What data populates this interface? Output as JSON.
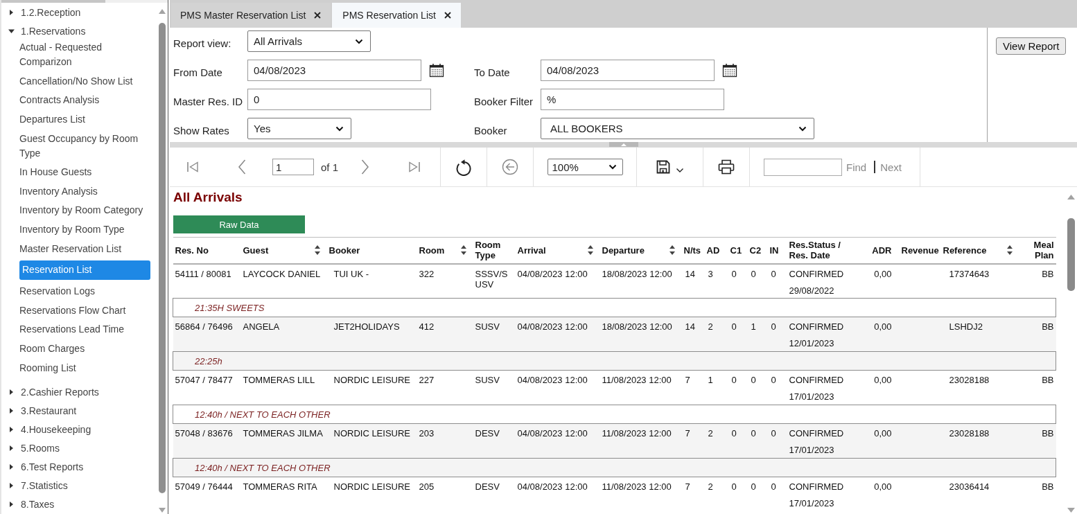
{
  "sidebar": {
    "items": [
      {
        "label": "1.2.Reception",
        "expanded": false
      },
      {
        "label": "1.Reservations",
        "expanded": true,
        "children": [
          {
            "label": "Actual - Requested Comparizon",
            "selected": false
          },
          {
            "label": "Cancellation/No Show List",
            "selected": false
          },
          {
            "label": "Contracts Analysis",
            "selected": false
          },
          {
            "label": "Departures List",
            "selected": false
          },
          {
            "label": "Guest Occupancy by Room Type",
            "selected": false
          },
          {
            "label": "In House Guests",
            "selected": false
          },
          {
            "label": "Inventory Analysis",
            "selected": false
          },
          {
            "label": "Inventory by Room Category",
            "selected": false
          },
          {
            "label": "Inventory by Room Type",
            "selected": false
          },
          {
            "label": "Master Reservation List",
            "selected": false
          },
          {
            "label": "Reservation List",
            "selected": true
          },
          {
            "label": "Reservation Logs",
            "selected": false
          },
          {
            "label": "Reservations Flow Chart",
            "selected": false
          },
          {
            "label": "Reservations Lead Time",
            "selected": false
          },
          {
            "label": "Room Charges",
            "selected": false
          },
          {
            "label": "Rooming List",
            "selected": false
          }
        ]
      },
      {
        "label": "2.Cashier Reports",
        "expanded": false
      },
      {
        "label": "3.Restaurant",
        "expanded": false
      },
      {
        "label": "4.Housekeeping",
        "expanded": false
      },
      {
        "label": "5.Rooms",
        "expanded": false
      },
      {
        "label": "6.Test Reports",
        "expanded": false
      },
      {
        "label": "7.Statistics",
        "expanded": false
      },
      {
        "label": "8.Taxes",
        "expanded": false
      }
    ]
  },
  "tabs": [
    {
      "label": "PMS Master Reservation List",
      "selected": false
    },
    {
      "label": "PMS Reservation List",
      "selected": true
    }
  ],
  "parameters": {
    "rows": [
      [
        {
          "label": "Report view:",
          "kind": "select",
          "value": "All Arrivals"
        }
      ],
      [
        {
          "label": "From Date",
          "kind": "date",
          "value": "04/08/2023"
        },
        {
          "label": "To Date",
          "kind": "date",
          "value": "04/08/2023"
        }
      ],
      [
        {
          "label": "Master Res. ID",
          "kind": "text",
          "value": "0"
        },
        {
          "label": "Booker Filter",
          "kind": "text",
          "value": "%"
        }
      ],
      [
        {
          "label": "Show Rates",
          "kind": "select",
          "value": "Yes"
        },
        {
          "label": "Booker",
          "kind": "select",
          "value": "ALL BOOKERS"
        }
      ]
    ],
    "view_report_button": "View Report"
  },
  "toolbar": {
    "groups": [
      [
        {
          "kind": "first",
          "disabled": true
        },
        {
          "kind": "previous",
          "disabled": true
        },
        {
          "kind": "page",
          "value": "1",
          "count": "of 1"
        },
        {
          "kind": "next",
          "disabled": true
        },
        {
          "kind": "last",
          "disabled": true
        }
      ],
      [
        {
          "kind": "refresh",
          "disabled": false
        }
      ],
      [
        {
          "kind": "back",
          "disabled": true
        }
      ],
      [
        {
          "kind": "zoom",
          "value": "100%"
        }
      ],
      [
        {
          "kind": "save",
          "disabled": false
        }
      ],
      [
        {
          "kind": "print",
          "disabled": false
        }
      ],
      [
        {
          "kind": "find",
          "find": "Find",
          "next": "Next",
          "disabled": true
        }
      ]
    ]
  },
  "report": {
    "title": "All Arrivals",
    "raw_data_button": "Raw Data",
    "table": {
      "columns": [
        {
          "label": "Res. No",
          "sortable": false
        },
        {
          "label": "Guest",
          "sortable": true
        },
        {
          "label": "Booker",
          "sortable": false
        },
        {
          "label": "Room",
          "sortable": true
        },
        {
          "label": "Room Type",
          "sortable": false
        },
        {
          "label": "Arrival",
          "sortable": true
        },
        {
          "label": "Departure",
          "sortable": true
        },
        {
          "label": "N/ts",
          "sortable": false
        },
        {
          "label": "AD",
          "sortable": false
        },
        {
          "label": "C1",
          "sortable": false
        },
        {
          "label": "C2",
          "sortable": false
        },
        {
          "label": "IN",
          "sortable": false
        },
        {
          "label": "Res.Status / Res. Date",
          "sortable": false
        },
        {
          "label": "ADR",
          "sortable": false
        },
        {
          "label": "Revenue",
          "sortable": false
        },
        {
          "label": "Reference",
          "sortable": true
        },
        {
          "label": "Meal Plan",
          "sortable": false
        }
      ],
      "rows": [
        {
          "res_no": "54111 / 80081",
          "guest": "LAYCOCK DANIEL",
          "booker": "TUI UK -",
          "room": "322",
          "room_type": "SSSV/SUSV",
          "arrival": "04/08/2023 12:00",
          "departure": "18/08/2023 12:00",
          "nights": "14",
          "ad": "3",
          "c1": "0",
          "c2": "0",
          "in": "0",
          "status": "CONFIRMED",
          "res_date": "29/08/2022",
          "adr": "0,00",
          "reference": "17374643",
          "meal_plan": "BB",
          "note": "21:35H SWEETS"
        },
        {
          "res_no": "56864 / 76496",
          "guest": "ANGELA",
          "booker": "JET2HOLIDAYS",
          "room": "412",
          "room_type": "SUSV",
          "arrival": "04/08/2023 12:00",
          "departure": "18/08/2023 12:00",
          "nights": "14",
          "ad": "2",
          "c1": "0",
          "c2": "1",
          "in": "0",
          "status": "CONFIRMED",
          "res_date": "12/01/2023",
          "adr": "0,00",
          "reference": "LSHDJ2",
          "meal_plan": "BB",
          "note": "22:25h"
        },
        {
          "res_no": "57047 / 78477",
          "guest": "TOMMERAS LILL",
          "booker": "NORDIC LEISURE",
          "room": "227",
          "room_type": "SUSV",
          "arrival": "04/08/2023 12:00",
          "departure": "11/08/2023 12:00",
          "nights": "7",
          "ad": "1",
          "c1": "0",
          "c2": "0",
          "in": "0",
          "status": "CONFIRMED",
          "res_date": "17/01/2023",
          "adr": "0,00",
          "reference": "23028188",
          "meal_plan": "BB",
          "note": "12:40h / NEXT TO EACH OTHER"
        },
        {
          "res_no": "57048 / 83676",
          "guest": "TOMMERAS JILMA",
          "booker": "NORDIC LEISURE",
          "room": "203",
          "room_type": "DESV",
          "arrival": "04/08/2023 12:00",
          "departure": "11/08/2023 12:00",
          "nights": "7",
          "ad": "2",
          "c1": "0",
          "c2": "0",
          "in": "0",
          "status": "CONFIRMED",
          "res_date": "17/01/2023",
          "adr": "0,00",
          "reference": "23028188",
          "meal_plan": "BB",
          "note": "12:40h / NEXT TO EACH OTHER"
        },
        {
          "res_no": "57049 / 76444",
          "guest": "TOMMERAS RITA",
          "booker": "NORDIC LEISURE",
          "room": "205",
          "room_type": "DESV",
          "arrival": "04/08/2023 12:00",
          "departure": "11/08/2023 12:00",
          "nights": "7",
          "ad": "2",
          "c1": "0",
          "c2": "0",
          "in": "0",
          "status": "CONFIRMED",
          "res_date": "17/01/2023",
          "adr": "0,00",
          "reference": "23036414",
          "meal_plan": "BB"
        }
      ]
    }
  }
}
